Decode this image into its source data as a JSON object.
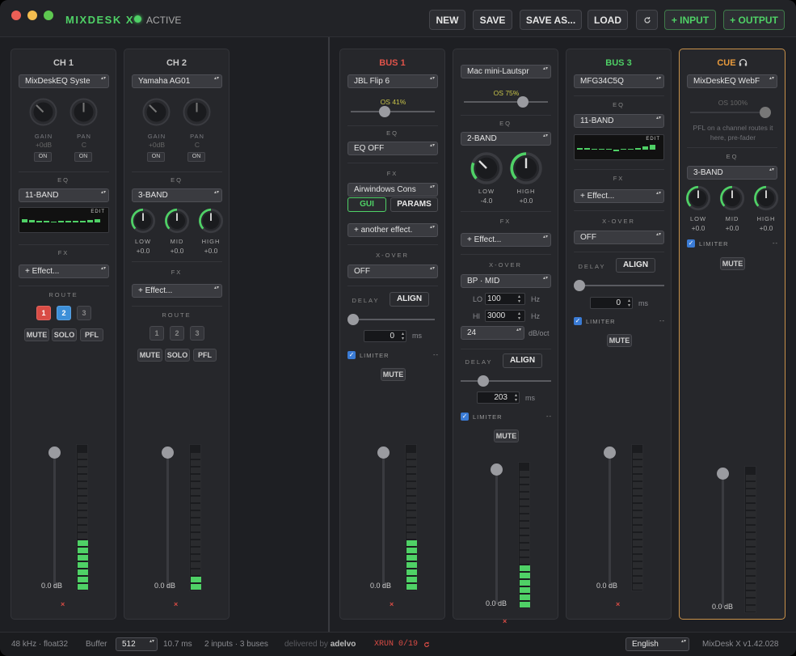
{
  "app": {
    "title": "MIXDESK X",
    "status": "ACTIVE",
    "version": "MixDesk X v1.42.028"
  },
  "toolbar": {
    "new": "NEW",
    "save": "SAVE",
    "save_as": "SAVE AS...",
    "load": "LOAD",
    "refresh_icon": "refresh-icon",
    "add_input": "+ INPUT",
    "add_output": "+ OUTPUT"
  },
  "colors": {
    "accent": "#4fd166",
    "bus1": "#e0534a",
    "cue": "#e89a3c",
    "route_1": "#d94c45",
    "route_2": "#3d8fd8"
  },
  "common": {
    "gain": "GAIN",
    "pan": "PAN",
    "on": "ON",
    "eq": "EQ",
    "fx": "FX",
    "route": "ROUTE",
    "mute": "MUTE",
    "solo": "SOLO",
    "pfl": "PFL",
    "edit": "EDIT",
    "low": "LOW",
    "mid": "MID",
    "high": "HIGH",
    "xover": "X-OVER",
    "delay": "DELAY",
    "align": "ALIGN",
    "limiter": "LIMITER",
    "ms": "ms",
    "hz": "Hz",
    "dboct": "dB/oct",
    "x": "×",
    "dash": "--",
    "gui": "GUI",
    "params": "PARAMS",
    "lo": "LO",
    "hi": "HI",
    "plus_zero": "+0.0",
    "route_1": "1",
    "route_2": "2",
    "route_3": "3"
  },
  "ch1": {
    "title": "CH 1",
    "device": "MixDeskEQ Syste",
    "gain_val": "+0dB",
    "pan_val": "C",
    "eq": "11-BAND",
    "fx": "+ Effect...",
    "db": "0.0 dB",
    "meter_level": 0.35
  },
  "ch2": {
    "title": "CH 2",
    "device": "Yamaha AG01",
    "gain_val": "+0dB",
    "pan_val": "C",
    "eq": "3-BAND",
    "fx": "+ Effect...",
    "low": "+0.0",
    "mid": "+0.0",
    "high": "+0.0",
    "db": "0.0 dB",
    "meter_level": 0.1
  },
  "bus1": {
    "title": "BUS 1",
    "device": "JBL Flip 6",
    "os": "OS 41%",
    "os_level": 0.41,
    "eq": "EQ OFF",
    "fx1": "Airwindows Cons",
    "fx2": "+ another effect.",
    "xover": "OFF",
    "delay": "0",
    "db": "0.0 dB",
    "meter_level": 0.35
  },
  "bus2": {
    "device": "Mac mini-Lautspr",
    "os": "OS 75%",
    "os_level": 0.75,
    "eq": "2-BAND",
    "low": "-4.0",
    "high": "+0.0",
    "fx": "+ Effect...",
    "xover": "BP · MID",
    "lo": "100",
    "hi": "3000",
    "slope": "24",
    "delay": "203",
    "db": "0.0 dB",
    "meter_level": 0.3
  },
  "bus3": {
    "title": "BUS 3",
    "device": "MFG34C5Q",
    "eq": "11-BAND",
    "fx": "+ Effect...",
    "xover": "OFF",
    "delay": "0",
    "db": "0.0 dB",
    "meter_level": 0.0
  },
  "cue": {
    "title": "CUE",
    "headphone_icon": "headphones-icon",
    "device": "MixDeskEQ WebF",
    "os": "OS 100%",
    "os_level": 1.0,
    "note": "PFL on a channel routes it here, pre-fader",
    "eq": "3-BAND",
    "low": "+0.0",
    "mid": "+0.0",
    "high": "+0.0",
    "db": "0.0 dB",
    "meter_level": 0.0
  },
  "statusbar": {
    "format": "48 kHz · float32",
    "buffer_label": "Buffer",
    "buffer": "512",
    "latency": "10.7 ms",
    "io": "2 inputs · 3 buses",
    "delivered": "delivered by",
    "brand": "adelvo",
    "xrun": "XRUN 0/19",
    "xrun_icon": "reset-icon",
    "language": "English"
  }
}
